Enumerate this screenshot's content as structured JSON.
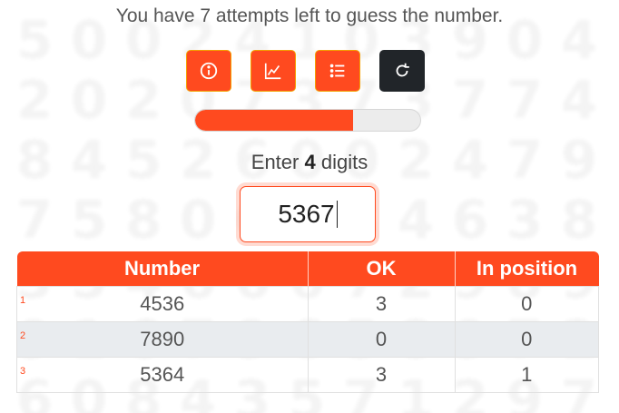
{
  "status_text": "You have 7 attempts left to guess the number.",
  "toolbar": {
    "buttons": [
      {
        "name": "info-button",
        "icon": "info-circle-icon"
      },
      {
        "name": "stats-button",
        "icon": "chart-line-icon"
      },
      {
        "name": "list-button",
        "icon": "list-icon"
      },
      {
        "name": "restart-button",
        "icon": "refresh-icon"
      }
    ]
  },
  "progress": {
    "fraction": 0.7
  },
  "prompt": {
    "prefix": "Enter",
    "count": "4",
    "suffix": "digits"
  },
  "guess": {
    "value": "5367"
  },
  "table": {
    "headers": [
      "Number",
      "OK",
      "In position"
    ],
    "rows": [
      {
        "index": "1",
        "number": "4536",
        "ok": "3",
        "in_position": "0"
      },
      {
        "index": "2",
        "number": "7890",
        "ok": "0",
        "in_position": "0"
      },
      {
        "index": "3",
        "number": "5364",
        "ok": "3",
        "in_position": "1"
      }
    ]
  },
  "colors": {
    "accent": "#ff4a1f",
    "dark": "#212529",
    "stripe": "#e9ecef"
  },
  "background_digits": [
    [
      "5",
      "0",
      "0",
      "2",
      "4",
      "1",
      "0",
      "3",
      "9",
      "0",
      "4"
    ],
    [
      "2",
      "0",
      "2",
      "0",
      "7",
      "3",
      "7",
      "3",
      "7",
      "7",
      "4"
    ],
    [
      "8",
      "4",
      "5",
      "2",
      "6",
      "0",
      "0",
      "2",
      "4",
      "7",
      "9"
    ],
    [
      "7",
      "5",
      "8",
      "0",
      "6",
      "1",
      "3",
      "4",
      "6",
      "3",
      "8"
    ],
    [
      "3",
      "5",
      "4",
      "6",
      "6",
      "6",
      "7",
      "2",
      "9",
      "8",
      "9"
    ],
    [
      "9",
      "1",
      "6",
      "7",
      "9",
      "6",
      "5",
      "8",
      "9",
      "7",
      "2"
    ],
    [
      "6",
      "0",
      "8",
      "4",
      "3",
      "5",
      "7",
      "1",
      "2",
      "9",
      "7"
    ]
  ]
}
